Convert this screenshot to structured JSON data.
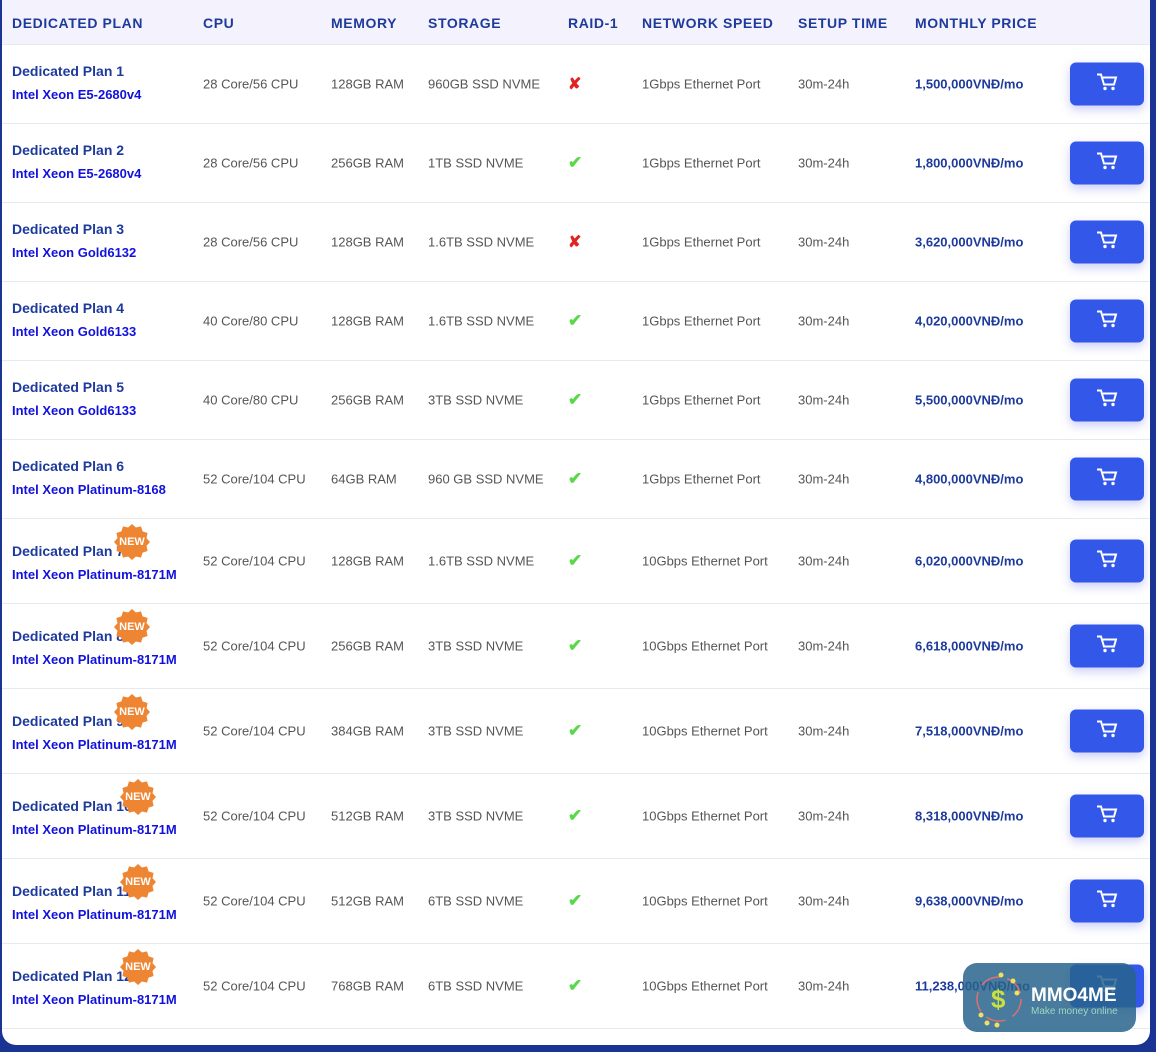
{
  "headers": [
    "DEDICATED PLAN",
    "CPU",
    "MEMORY",
    "STORAGE",
    "RAID-1",
    "NETWORK SPEED",
    "SETUP TIME",
    "MONTHLY PRICE"
  ],
  "badge": "NEW",
  "plans": [
    {
      "name": "Dedicated Plan 1",
      "cpu_model": "Intel Xeon E5-2680v4",
      "cores": "28 Core/56 CPU",
      "memory": "128GB RAM",
      "storage": "960GB SSD NVME",
      "raid": false,
      "network": "1Gbps Ethernet Port",
      "setup": "30m-24h",
      "price": "1,500,000VNĐ/mo",
      "new": false
    },
    {
      "name": "Dedicated Plan 2",
      "cpu_model": "Intel Xeon E5-2680v4",
      "cores": "28 Core/56 CPU",
      "memory": "256GB RAM",
      "storage": "1TB SSD NVME",
      "raid": true,
      "network": "1Gbps Ethernet Port",
      "setup": "30m-24h",
      "price": "1,800,000VNĐ/mo",
      "new": false
    },
    {
      "name": "Dedicated Plan 3",
      "cpu_model": "Intel Xeon Gold6132",
      "cores": "28 Core/56 CPU",
      "memory": "128GB RAM",
      "storage": "1.6TB SSD NVME",
      "raid": false,
      "network": "1Gbps Ethernet Port",
      "setup": "30m-24h",
      "price": "3,620,000VNĐ/mo",
      "new": false
    },
    {
      "name": "Dedicated Plan 4",
      "cpu_model": "Intel Xeon Gold6133",
      "cores": "40 Core/80 CPU",
      "memory": "128GB RAM",
      "storage": "1.6TB SSD NVME",
      "raid": true,
      "network": "1Gbps Ethernet Port",
      "setup": "30m-24h",
      "price": "4,020,000VNĐ/mo",
      "new": false
    },
    {
      "name": "Dedicated Plan 5",
      "cpu_model": "Intel Xeon Gold6133",
      "cores": "40 Core/80 CPU",
      "memory": "256GB RAM",
      "storage": "3TB SSD NVME",
      "raid": true,
      "network": "1Gbps Ethernet Port",
      "setup": "30m-24h",
      "price": "5,500,000VNĐ/mo",
      "new": false
    },
    {
      "name": "Dedicated Plan 6",
      "cpu_model": "Intel Xeon Platinum-8168",
      "cores": "52 Core/104 CPU",
      "memory": "64GB RAM",
      "storage": "960 GB SSD NVME",
      "raid": true,
      "network": "1Gbps Ethernet Port",
      "setup": "30m-24h",
      "price": "4,800,000VNĐ/mo",
      "new": false
    },
    {
      "name": "Dedicated Plan 7",
      "cpu_model": "Intel Xeon Platinum-8171M",
      "cores": "52 Core/104 CPU",
      "memory": "128GB RAM",
      "storage": "1.6TB SSD NVME",
      "raid": true,
      "network": "10Gbps Ethernet Port",
      "setup": "30m-24h",
      "price": "6,020,000VNĐ/mo",
      "new": true
    },
    {
      "name": "Dedicated Plan 8",
      "cpu_model": "Intel Xeon Platinum-8171M",
      "cores": "52 Core/104 CPU",
      "memory": "256GB RAM",
      "storage": "3TB SSD NVME",
      "raid": true,
      "network": "10Gbps Ethernet Port",
      "setup": "30m-24h",
      "price": "6,618,000VNĐ/mo",
      "new": true
    },
    {
      "name": "Dedicated Plan 9",
      "cpu_model": "Intel Xeon Platinum-8171M",
      "cores": "52 Core/104 CPU",
      "memory": "384GB RAM",
      "storage": "3TB SSD NVME",
      "raid": true,
      "network": "10Gbps Ethernet Port",
      "setup": "30m-24h",
      "price": "7,518,000VNĐ/mo",
      "new": true
    },
    {
      "name": "Dedicated Plan 10",
      "cpu_model": "Intel Xeon Platinum-8171M",
      "cores": "52 Core/104 CPU",
      "memory": "512GB RAM",
      "storage": "3TB SSD NVME",
      "raid": true,
      "network": "10Gbps Ethernet Port",
      "setup": "30m-24h",
      "price": "8,318,000VNĐ/mo",
      "new": true
    },
    {
      "name": "Dedicated Plan 11",
      "cpu_model": "Intel Xeon Platinum-8171M",
      "cores": "52 Core/104 CPU",
      "memory": "512GB RAM",
      "storage": "6TB SSD NVME",
      "raid": true,
      "network": "10Gbps Ethernet Port",
      "setup": "30m-24h",
      "price": "9,638,000VNĐ/mo",
      "new": true
    },
    {
      "name": "Dedicated Plan 12",
      "cpu_model": "Intel Xeon Platinum-8171M",
      "cores": "52 Core/104 CPU",
      "memory": "768GB RAM",
      "storage": "6TB SSD NVME",
      "raid": true,
      "network": "10Gbps Ethernet Port",
      "setup": "30m-24h",
      "price": "11,238,000VNĐ/mo",
      "new": true
    }
  ],
  "watermark": {
    "title": "MMO4ME",
    "subtitle": "Make money online"
  },
  "colors": {
    "accent": "#3357e8",
    "heading": "#1d3a9c",
    "badge": "#ee8533",
    "ok": "#5ad84a",
    "no": "#e02424"
  }
}
